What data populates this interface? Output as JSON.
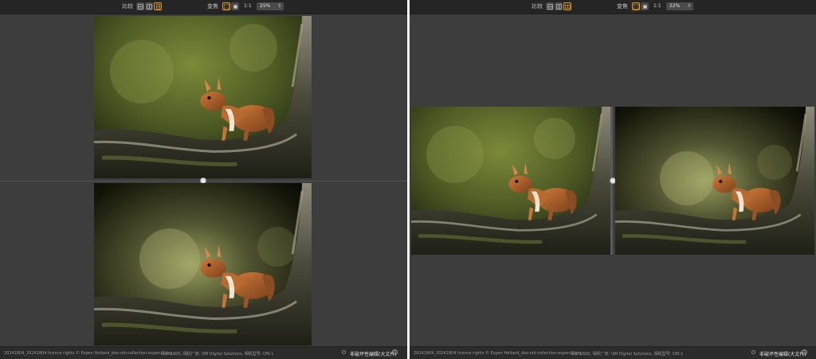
{
  "left": {
    "toolbar": {
      "compare_label": "比较",
      "transform_label": "变焦",
      "one_to_one": "1:1",
      "zoom_value": "25%"
    },
    "status": {
      "filename": "20241804_20241804 licence rights © Espen Helland_dxo-nik-collection-espen-2.jpg",
      "meta": "ISO: 1600, 相机厂商: OM Digital Solutions, 相机型号: OM-1",
      "mode": "非破坏性编辑(大文件)",
      "help": "?"
    }
  },
  "right": {
    "toolbar": {
      "compare_label": "比较",
      "transform_label": "变焦",
      "one_to_one": "1:1",
      "zoom_value": "22%"
    },
    "status": {
      "filename": "20241804_20241804 licence rights © Espen Helland_dxo-nik-collection-espen-2.jpg",
      "meta": "ISO: 1600, 相机厂商: OM Digital Solutions, 相机型号: OM-1",
      "mode": "非破坏性编辑(大文件)",
      "help": "?"
    }
  },
  "icons": {
    "compare_modes": [
      "split-view-icon",
      "side-by-side-icon",
      "single-view-icon"
    ],
    "transform_modes": [
      "fit-icon",
      "fill-icon"
    ]
  },
  "colors": {
    "accent": "#e39a2b",
    "panel": "#3d3d3d",
    "toolbar": "#252525"
  }
}
